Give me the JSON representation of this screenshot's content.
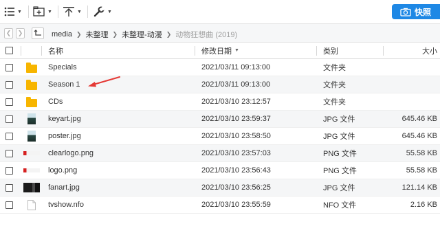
{
  "toolbar": {
    "list_icon": "list-view-icon",
    "new_icon": "new-folder-icon",
    "upload_icon": "upload-icon",
    "tools_icon": "wrench-icon",
    "snapshot_label": "快照",
    "snapshot_icon": "camera-icon"
  },
  "address": {
    "crumbs": [
      "media",
      "未整理",
      "未整理-动漫",
      "动物狂想曲 (2019)"
    ]
  },
  "columns": {
    "name": "名称",
    "date": "修改日期",
    "type": "类别",
    "size": "大小"
  },
  "files": [
    {
      "name": "Specials",
      "date": "2021/03/11 09:13:00",
      "type": "文件夹",
      "size": "",
      "icon": "folder-icon"
    },
    {
      "name": "Season 1",
      "date": "2021/03/11 09:13:00",
      "type": "文件夹",
      "size": "",
      "icon": "folder-icon"
    },
    {
      "name": "CDs",
      "date": "2021/03/10 23:12:57",
      "type": "文件夹",
      "size": "",
      "icon": "folder-icon"
    },
    {
      "name": "keyart.jpg",
      "date": "2021/03/10 23:59:37",
      "type": "JPG 文件",
      "size": "645.46 KB",
      "icon": "image-thumbnail"
    },
    {
      "name": "poster.jpg",
      "date": "2021/03/10 23:58:50",
      "type": "JPG 文件",
      "size": "645.46 KB",
      "icon": "image-thumbnail"
    },
    {
      "name": "clearlogo.png",
      "date": "2021/03/10 23:57:03",
      "type": "PNG 文件",
      "size": "55.58 KB",
      "icon": "image-thumbnail"
    },
    {
      "name": "logo.png",
      "date": "2021/03/10 23:56:43",
      "type": "PNG 文件",
      "size": "55.58 KB",
      "icon": "image-thumbnail"
    },
    {
      "name": "fanart.jpg",
      "date": "2021/03/10 23:56:25",
      "type": "JPG 文件",
      "size": "121.14 KB",
      "icon": "image-thumbnail"
    },
    {
      "name": "tvshow.nfo",
      "date": "2021/03/10 23:55:59",
      "type": "NFO 文件",
      "size": "2.16 KB",
      "icon": "file-icon"
    }
  ],
  "colors": {
    "accent": "#1e88e5",
    "folder": "#f7b500",
    "annotation_arrow": "#e53935"
  }
}
